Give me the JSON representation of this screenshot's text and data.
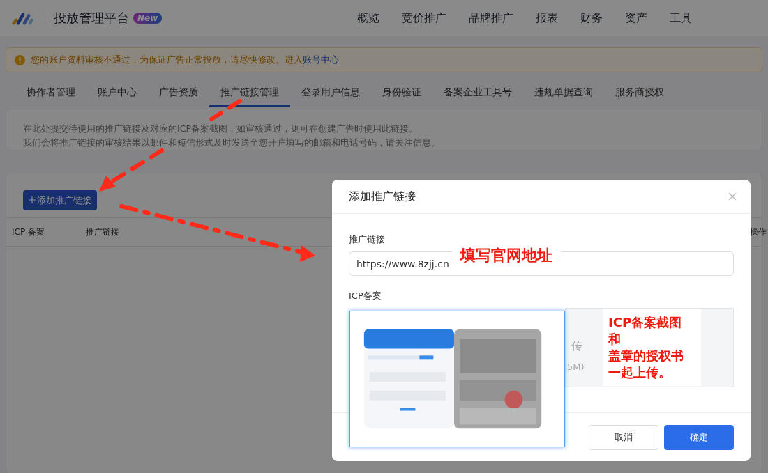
{
  "header": {
    "title": "投放管理平台",
    "badge": "New",
    "nav": [
      {
        "label": "概览"
      },
      {
        "label": "竞价推广"
      },
      {
        "label": "品牌推广"
      },
      {
        "label": "报表"
      },
      {
        "label": "财务"
      },
      {
        "label": "资产"
      },
      {
        "label": "工具"
      }
    ]
  },
  "alert": {
    "text": "您的账户资料审核不通过，为保证广告正常投放，请尽快修改。进入",
    "link": "账号中心"
  },
  "tabs": [
    {
      "label": "协作者管理",
      "selected": false
    },
    {
      "label": "账户中心",
      "selected": false
    },
    {
      "label": "广告资质",
      "selected": false
    },
    {
      "label": "推广链接管理",
      "selected": true
    },
    {
      "label": "登录用户信息",
      "selected": false
    },
    {
      "label": "身份验证",
      "selected": false
    },
    {
      "label": "备案企业工具号",
      "selected": false
    },
    {
      "label": "违规单据查询",
      "selected": false
    },
    {
      "label": "服务商授权",
      "selected": false
    }
  ],
  "description": [
    "在此处提交待使用的推广链接及对应的ICP备案截图，如审核通过，则可在创建广告时使用此链接。",
    "我们会将推广链接的审核结果以邮件和短信形式及时发送至您开户填写的邮箱和电话号码，请关注信息。"
  ],
  "add_button": {
    "label": "添加推广链接"
  },
  "table": {
    "columns": [
      "ICP 备案",
      "推广链接",
      "操作"
    ]
  },
  "modal": {
    "title": "添加推广链接",
    "link_field": {
      "label": "推广链接",
      "value": "https://www.8zjj.cn"
    },
    "icp_field": {
      "label": "ICP备案",
      "upload_text": "传",
      "upload_hint": "5M)"
    },
    "buttons": [
      {
        "label": "取消",
        "kind": "secondary"
      },
      {
        "label": "确定",
        "kind": "primary"
      }
    ]
  },
  "annotations": [
    {
      "kind": "label",
      "lines": [
        "填写官网地址"
      ]
    },
    {
      "kind": "note",
      "lines": [
        "ICP备案截图",
        "和",
        "盖章的授权书",
        "一起上传。"
      ]
    }
  ],
  "uploaded_image": {
    "kind": "picture"
  }
}
